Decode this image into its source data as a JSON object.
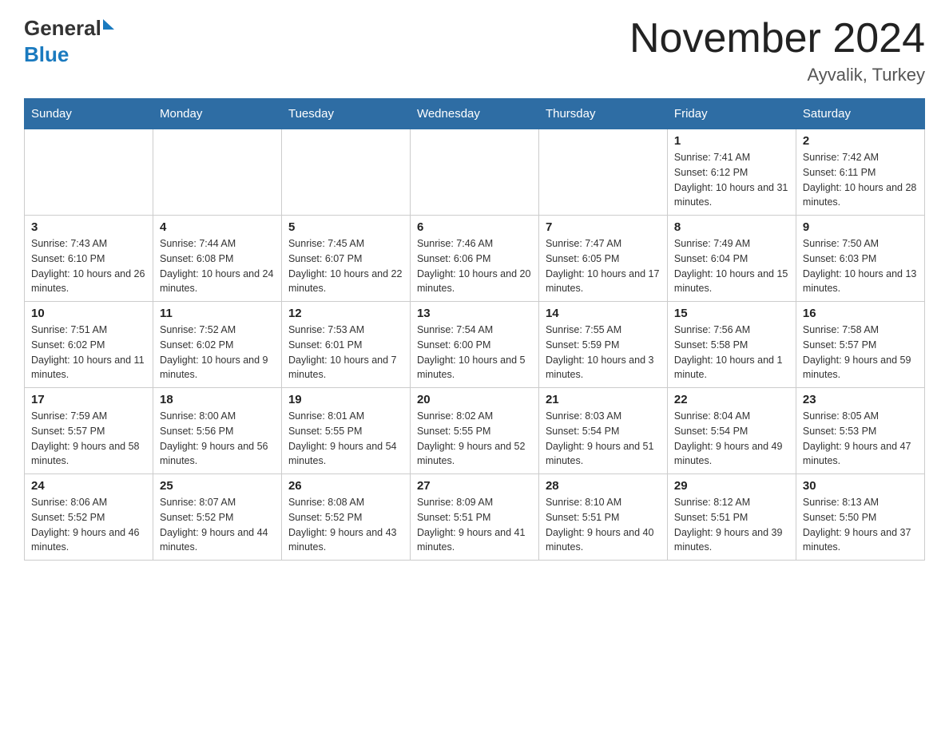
{
  "logo": {
    "general": "General",
    "blue": "Blue"
  },
  "header": {
    "title": "November 2024",
    "subtitle": "Ayvalik, Turkey"
  },
  "weekdays": [
    "Sunday",
    "Monday",
    "Tuesday",
    "Wednesday",
    "Thursday",
    "Friday",
    "Saturday"
  ],
  "weeks": [
    [
      {
        "day": "",
        "sunrise": "",
        "sunset": "",
        "daylight": ""
      },
      {
        "day": "",
        "sunrise": "",
        "sunset": "",
        "daylight": ""
      },
      {
        "day": "",
        "sunrise": "",
        "sunset": "",
        "daylight": ""
      },
      {
        "day": "",
        "sunrise": "",
        "sunset": "",
        "daylight": ""
      },
      {
        "day": "",
        "sunrise": "",
        "sunset": "",
        "daylight": ""
      },
      {
        "day": "1",
        "sunrise": "Sunrise: 7:41 AM",
        "sunset": "Sunset: 6:12 PM",
        "daylight": "Daylight: 10 hours and 31 minutes."
      },
      {
        "day": "2",
        "sunrise": "Sunrise: 7:42 AM",
        "sunset": "Sunset: 6:11 PM",
        "daylight": "Daylight: 10 hours and 28 minutes."
      }
    ],
    [
      {
        "day": "3",
        "sunrise": "Sunrise: 7:43 AM",
        "sunset": "Sunset: 6:10 PM",
        "daylight": "Daylight: 10 hours and 26 minutes."
      },
      {
        "day": "4",
        "sunrise": "Sunrise: 7:44 AM",
        "sunset": "Sunset: 6:08 PM",
        "daylight": "Daylight: 10 hours and 24 minutes."
      },
      {
        "day": "5",
        "sunrise": "Sunrise: 7:45 AM",
        "sunset": "Sunset: 6:07 PM",
        "daylight": "Daylight: 10 hours and 22 minutes."
      },
      {
        "day": "6",
        "sunrise": "Sunrise: 7:46 AM",
        "sunset": "Sunset: 6:06 PM",
        "daylight": "Daylight: 10 hours and 20 minutes."
      },
      {
        "day": "7",
        "sunrise": "Sunrise: 7:47 AM",
        "sunset": "Sunset: 6:05 PM",
        "daylight": "Daylight: 10 hours and 17 minutes."
      },
      {
        "day": "8",
        "sunrise": "Sunrise: 7:49 AM",
        "sunset": "Sunset: 6:04 PM",
        "daylight": "Daylight: 10 hours and 15 minutes."
      },
      {
        "day": "9",
        "sunrise": "Sunrise: 7:50 AM",
        "sunset": "Sunset: 6:03 PM",
        "daylight": "Daylight: 10 hours and 13 minutes."
      }
    ],
    [
      {
        "day": "10",
        "sunrise": "Sunrise: 7:51 AM",
        "sunset": "Sunset: 6:02 PM",
        "daylight": "Daylight: 10 hours and 11 minutes."
      },
      {
        "day": "11",
        "sunrise": "Sunrise: 7:52 AM",
        "sunset": "Sunset: 6:02 PM",
        "daylight": "Daylight: 10 hours and 9 minutes."
      },
      {
        "day": "12",
        "sunrise": "Sunrise: 7:53 AM",
        "sunset": "Sunset: 6:01 PM",
        "daylight": "Daylight: 10 hours and 7 minutes."
      },
      {
        "day": "13",
        "sunrise": "Sunrise: 7:54 AM",
        "sunset": "Sunset: 6:00 PM",
        "daylight": "Daylight: 10 hours and 5 minutes."
      },
      {
        "day": "14",
        "sunrise": "Sunrise: 7:55 AM",
        "sunset": "Sunset: 5:59 PM",
        "daylight": "Daylight: 10 hours and 3 minutes."
      },
      {
        "day": "15",
        "sunrise": "Sunrise: 7:56 AM",
        "sunset": "Sunset: 5:58 PM",
        "daylight": "Daylight: 10 hours and 1 minute."
      },
      {
        "day": "16",
        "sunrise": "Sunrise: 7:58 AM",
        "sunset": "Sunset: 5:57 PM",
        "daylight": "Daylight: 9 hours and 59 minutes."
      }
    ],
    [
      {
        "day": "17",
        "sunrise": "Sunrise: 7:59 AM",
        "sunset": "Sunset: 5:57 PM",
        "daylight": "Daylight: 9 hours and 58 minutes."
      },
      {
        "day": "18",
        "sunrise": "Sunrise: 8:00 AM",
        "sunset": "Sunset: 5:56 PM",
        "daylight": "Daylight: 9 hours and 56 minutes."
      },
      {
        "day": "19",
        "sunrise": "Sunrise: 8:01 AM",
        "sunset": "Sunset: 5:55 PM",
        "daylight": "Daylight: 9 hours and 54 minutes."
      },
      {
        "day": "20",
        "sunrise": "Sunrise: 8:02 AM",
        "sunset": "Sunset: 5:55 PM",
        "daylight": "Daylight: 9 hours and 52 minutes."
      },
      {
        "day": "21",
        "sunrise": "Sunrise: 8:03 AM",
        "sunset": "Sunset: 5:54 PM",
        "daylight": "Daylight: 9 hours and 51 minutes."
      },
      {
        "day": "22",
        "sunrise": "Sunrise: 8:04 AM",
        "sunset": "Sunset: 5:54 PM",
        "daylight": "Daylight: 9 hours and 49 minutes."
      },
      {
        "day": "23",
        "sunrise": "Sunrise: 8:05 AM",
        "sunset": "Sunset: 5:53 PM",
        "daylight": "Daylight: 9 hours and 47 minutes."
      }
    ],
    [
      {
        "day": "24",
        "sunrise": "Sunrise: 8:06 AM",
        "sunset": "Sunset: 5:52 PM",
        "daylight": "Daylight: 9 hours and 46 minutes."
      },
      {
        "day": "25",
        "sunrise": "Sunrise: 8:07 AM",
        "sunset": "Sunset: 5:52 PM",
        "daylight": "Daylight: 9 hours and 44 minutes."
      },
      {
        "day": "26",
        "sunrise": "Sunrise: 8:08 AM",
        "sunset": "Sunset: 5:52 PM",
        "daylight": "Daylight: 9 hours and 43 minutes."
      },
      {
        "day": "27",
        "sunrise": "Sunrise: 8:09 AM",
        "sunset": "Sunset: 5:51 PM",
        "daylight": "Daylight: 9 hours and 41 minutes."
      },
      {
        "day": "28",
        "sunrise": "Sunrise: 8:10 AM",
        "sunset": "Sunset: 5:51 PM",
        "daylight": "Daylight: 9 hours and 40 minutes."
      },
      {
        "day": "29",
        "sunrise": "Sunrise: 8:12 AM",
        "sunset": "Sunset: 5:51 PM",
        "daylight": "Daylight: 9 hours and 39 minutes."
      },
      {
        "day": "30",
        "sunrise": "Sunrise: 8:13 AM",
        "sunset": "Sunset: 5:50 PM",
        "daylight": "Daylight: 9 hours and 37 minutes."
      }
    ]
  ]
}
